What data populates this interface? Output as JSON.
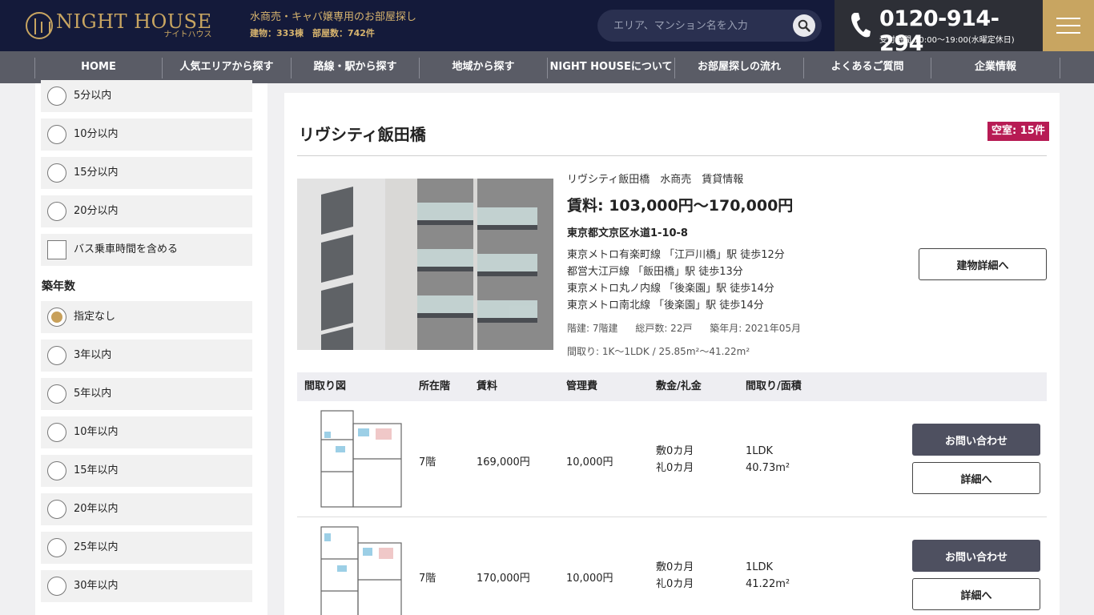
{
  "header": {
    "logo_en": "NIGHT HOUSE",
    "logo_ja": "ナイトハウス",
    "tagline": "水商売・キャバ嬢専用のお部屋探し",
    "stats": "建物：333棟　部屋数：742件",
    "search_placeholder": "エリア、マンション名を入力",
    "phone": "0120-914-294",
    "hours": "受付時間 10:00～19:00(水曜定休日)"
  },
  "nav": [
    "HOME",
    "人気エリアから探す",
    "路線・駅から探す",
    "地域から探す",
    "NIGHT HOUSEについて",
    "お部屋探しの流れ",
    "よくあるご質問",
    "企業情報"
  ],
  "sidebar": {
    "walk_options": [
      "5分以内",
      "10分以内",
      "15分以内",
      "20分以内"
    ],
    "bus_option": "バス乗車時間を含める",
    "age_heading": "築年数",
    "age_options": [
      "指定なし",
      "3年以内",
      "5年以内",
      "10年以内",
      "15年以内",
      "20年以内",
      "25年以内",
      "30年以内"
    ],
    "age_selected": "指定なし"
  },
  "building": {
    "name": "リヴシティ飯田橋",
    "vacancy": "空室: 15件",
    "title": "リヴシティ飯田橋　水商売　賃貸情報",
    "rent": "賃料: 103,000円～170,000円",
    "address": "東京都文京区水道1-10-8",
    "access": [
      "東京メトロ有楽町線 「江戸川橋」駅 徒歩12分",
      "都営大江戸線 「飯田橋」駅 徒歩13分",
      "東京メトロ丸ノ内線 「後楽園」駅 徒歩14分",
      "東京メトロ南北線 「後楽園」駅 徒歩14分"
    ],
    "floors": "階建: 7階建",
    "units": "総戸数: 22戸",
    "built": "築年月: 2021年05月",
    "layout": "間取り: 1K～1LDK / 25.85m²～41.22m²",
    "detail_button": "建物詳細へ"
  },
  "table": {
    "headers": [
      "間取り図",
      "所在階",
      "賃料",
      "管理費",
      "敷金/礼金",
      "間取り/面積"
    ],
    "rows": [
      {
        "floor": "7階",
        "rent": "169,000円",
        "fee": "10,000円",
        "deposit": "敷0カ月",
        "key_money": "礼0カ月",
        "layout": "1LDK",
        "area": "40.73m²"
      },
      {
        "floor": "7階",
        "rent": "170,000円",
        "fee": "10,000円",
        "deposit": "敷0カ月",
        "key_money": "礼0カ月",
        "layout": "1LDK",
        "area": "41.22m²"
      }
    ],
    "inquiry_button": "お問い合わせ",
    "detail_button": "詳細へ"
  },
  "colors": {
    "navy": "#141a3a",
    "gold": "#c8a561",
    "nav": "#5a5c66",
    "vacancy": "#b71b54"
  }
}
